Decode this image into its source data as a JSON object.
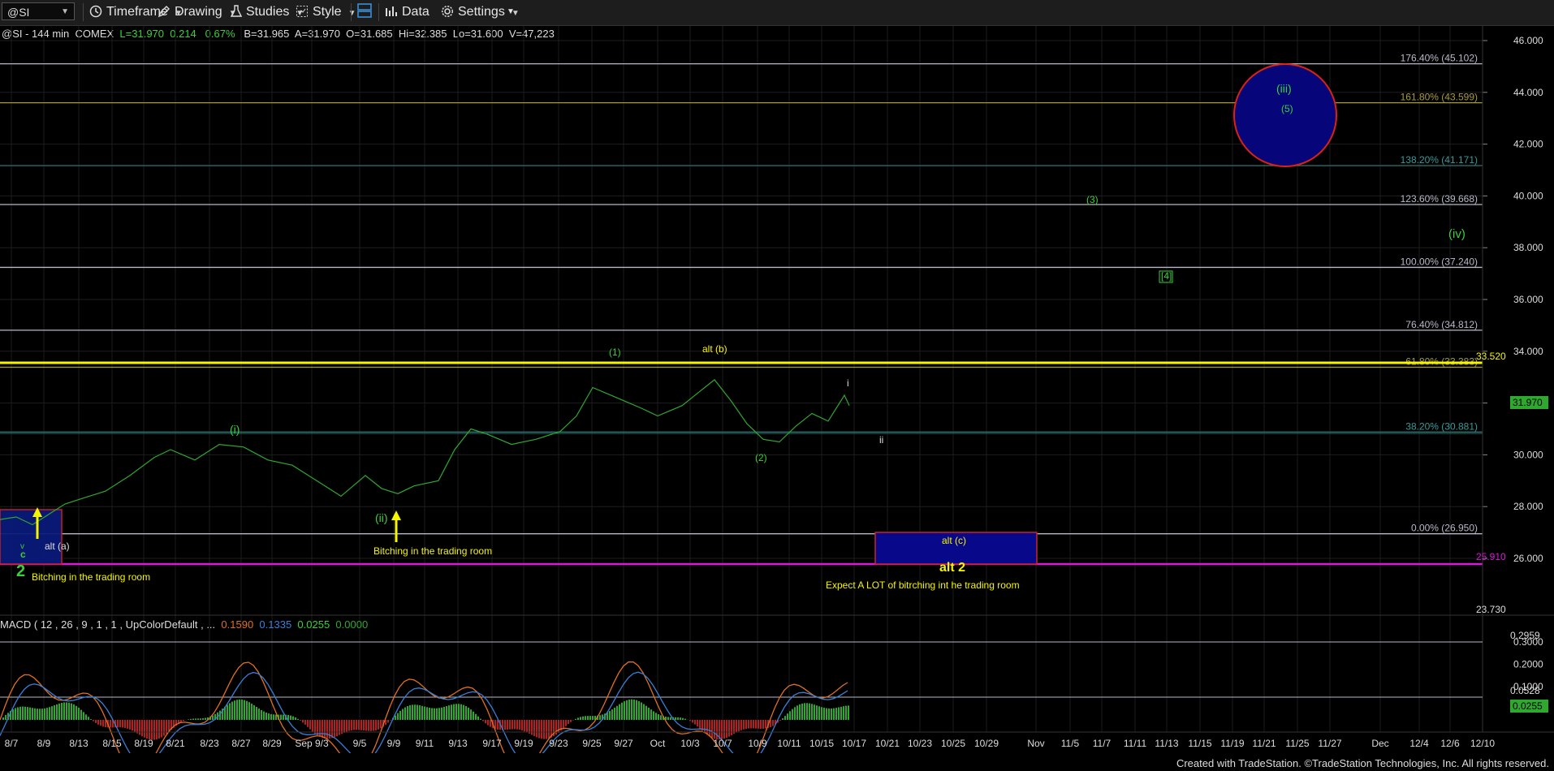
{
  "toolbar": {
    "symbol": "@SI",
    "timeframe": "Timeframe",
    "drawing": "Drawing",
    "studies": "Studies",
    "style": "Style",
    "data": "Data",
    "settings": "Settings"
  },
  "header": {
    "title": "@SI - 144 min",
    "exchange": "COMEX",
    "last": "L=31.970",
    "change": "0.214",
    "change_pct": "0.67%",
    "bid": "B=31.965",
    "ask": "A=31.970",
    "open": "O=31.685",
    "high": "Hi=32.385",
    "low": "Lo=31.600",
    "volume": "V=47,223"
  },
  "price_axis": {
    "ticks": [
      "46.000",
      "44.000",
      "42.000",
      "40.000",
      "38.000",
      "36.000",
      "34.000",
      "32.000",
      "30.000",
      "28.000",
      "26.000"
    ],
    "last_price": "31.970",
    "top_price": "33.520",
    "bottom_price": "23.730",
    "purple_level": "25.910"
  },
  "fib_levels": [
    {
      "label": "176.40% (45.102)",
      "price": 45.102,
      "color": "#b8b8c8"
    },
    {
      "label": "161.80% (43.599)",
      "price": 43.599,
      "color": "#a89a3a"
    },
    {
      "label": "138.20% (41.171)",
      "price": 41.171,
      "color": "#2d6b6b"
    },
    {
      "label": "123.60% (39.668)",
      "price": 39.668,
      "color": "#b8b8c8"
    },
    {
      "label": "100.00% (37.240)",
      "price": 37.24,
      "color": "#b8b8c8"
    },
    {
      "label": "76.40% (34.812)",
      "price": 34.812,
      "color": "#b8b8c8"
    },
    {
      "label": "61.80% (33.383)",
      "price": 33.383,
      "color": "#a89a3a"
    },
    {
      "label": "38.20% (30.881)",
      "price": 30.881,
      "color": "#2d6b6b"
    },
    {
      "label": "0.00% (26.950)",
      "price": 26.95,
      "color": "#b8b8c8"
    }
  ],
  "annotations": {
    "wave_1": "(1)",
    "alt_b": "alt (b)",
    "wave_i_small": "i",
    "wave_ii_small": "ii",
    "wave_2": "(2)",
    "wave_i": "(i)",
    "wave_ii": "(ii)",
    "wave_3": "(3)",
    "wave_4": "[4]",
    "wave_iv": "(iv)",
    "wave_iii": "(iii)",
    "wave_5": "(5)",
    "alt_a": "alt (a)",
    "alt_c": "alt (c)",
    "alt_2": "alt 2",
    "big_2": "2",
    "v_mark": "v",
    "c_mark": "c",
    "trading_room_1": "Bitching in the trading room",
    "trading_room_2": "Bitching in the trading room",
    "trading_room_3": "Expect A LOT of bitrching int he trading room"
  },
  "macd": {
    "header": "MACD ( 12 , 26 , 9 , 1 , 1 , UpColorDefault , ...",
    "v1": "0.1590",
    "v2": "0.1335",
    "v3": "0.0255",
    "v4": "0.0000",
    "axis_ticks": [
      "0.3000",
      "0.2000",
      "0.1000",
      "0.0000"
    ],
    "top_level": "0.2959",
    "mid_level": "0.0528",
    "last": "0.0255"
  },
  "time_axis": [
    "8/7",
    "8/9",
    "8/13",
    "8/15",
    "8/19",
    "8/21",
    "8/23",
    "8/27",
    "8/29",
    "Sep 9/3",
    "9/5",
    "9/9",
    "9/11",
    "9/13",
    "9/17",
    "9/19",
    "9/23",
    "9/25",
    "9/27",
    "Oct",
    "10/3",
    "10/7",
    "10/9",
    "10/11",
    "10/15",
    "10/17",
    "10/21",
    "10/23",
    "10/25",
    "10/29",
    "Nov",
    "11/5",
    "11/7",
    "11/11",
    "11/13",
    "11/15",
    "11/19",
    "11/21",
    "11/25",
    "11/27",
    "Dec",
    "12/4",
    "12/6",
    "12/10"
  ],
  "footer": "Created with TradeStation. ©TradeStation Technologies, Inc. All rights reserved.",
  "colors": {
    "up": "#2fa82f",
    "down": "#b22222",
    "yellow": "#f5f500",
    "magenta": "#d81ad8",
    "fib_green": "#39d139",
    "circle": "#0a0a8a"
  }
}
